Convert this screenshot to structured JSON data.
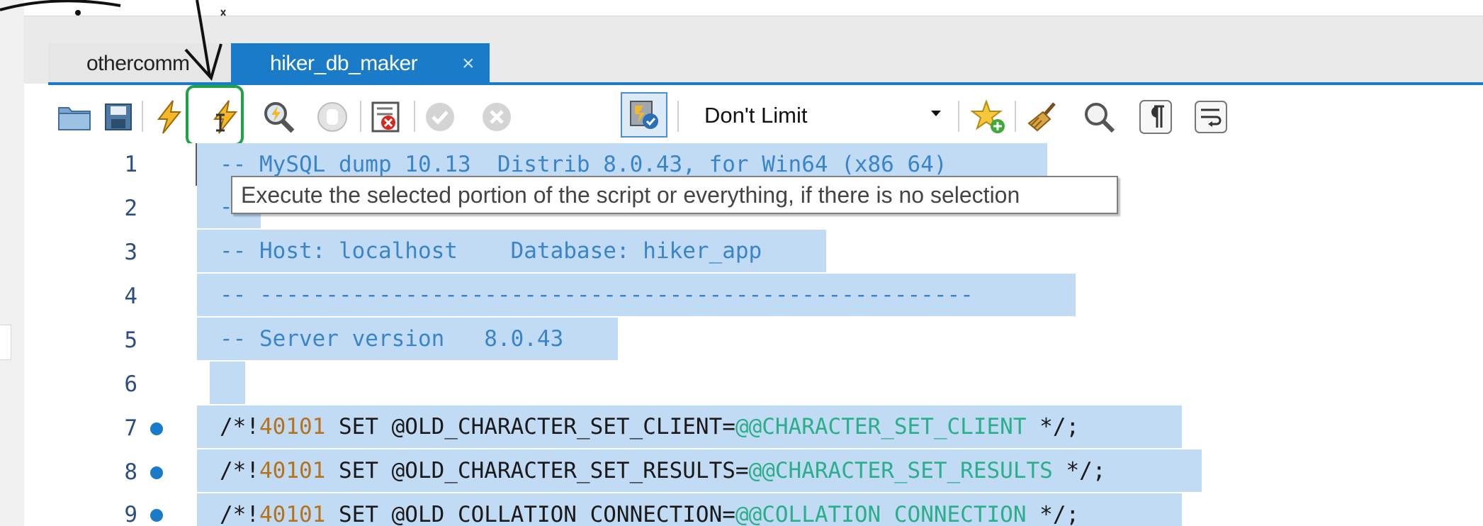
{
  "tabs": [
    {
      "label": "othercomm",
      "active": false
    },
    {
      "label": "hiker_db_maker",
      "active": true,
      "close_glyph": "×"
    }
  ],
  "toolbar": {
    "buttons": [
      {
        "name": "open-file-button",
        "icon": "folder-icon"
      },
      {
        "name": "save-file-button",
        "icon": "save-icon"
      },
      {
        "name": "execute-button",
        "icon": "lightning-icon"
      },
      {
        "name": "execute-current-statement-button",
        "icon": "lightning-cursor-icon"
      },
      {
        "name": "explain-button",
        "icon": "magnifier-lightning-icon"
      },
      {
        "name": "stop-button",
        "icon": "hand-stop-icon"
      },
      {
        "name": "toggle-error-stop-button",
        "icon": "error-stop-icon"
      },
      {
        "name": "commit-button",
        "icon": "check-icon"
      },
      {
        "name": "rollback-button",
        "icon": "cancel-icon"
      },
      {
        "name": "autocommit-toggle-button",
        "icon": "autocommit-icon"
      },
      {
        "name": "add-snippet-button",
        "icon": "star-plus-icon"
      },
      {
        "name": "beautify-button",
        "icon": "broom-icon"
      },
      {
        "name": "find-button",
        "icon": "magnifier-icon"
      },
      {
        "name": "invisible-chars-button",
        "icon": "pilcrow-icon"
      },
      {
        "name": "word-wrap-button",
        "icon": "wrap-icon"
      }
    ],
    "limit_select": {
      "value": "Don't Limit"
    }
  },
  "tooltip": {
    "text": "Execute the selected portion of the script or everything, if there is no selection"
  },
  "editor": {
    "lines": [
      {
        "num": "1",
        "text": "-- MySQL dump 10.13  Distrib 8.0.43, for Win64 (x86_64)"
      },
      {
        "num": "2",
        "text": "--"
      },
      {
        "num": "3",
        "text": "-- Host: localhost    Database: hiker_app"
      },
      {
        "num": "4",
        "text": "-- ------------------------------------------------------"
      },
      {
        "num": "5",
        "text": "-- Server version   8.0.43"
      },
      {
        "num": "6",
        "text": ""
      },
      {
        "num": "7",
        "prefix": "/*!",
        "ver": "40101",
        "kw": " SET @OLD_CHARACTER_SET_CLIENT=",
        "sys": "@@CHARACTER_SET_CLIENT",
        "tail": " */;"
      },
      {
        "num": "8",
        "prefix": "/*!",
        "ver": "40101",
        "kw": " SET @OLD_CHARACTER_SET_RESULTS=",
        "sys": "@@CHARACTER_SET_RESULTS",
        "tail": " */;"
      },
      {
        "num": "9",
        "prefix": "/*!",
        "ver": "40101",
        "kw": " SET @OLD_COLLATION_CONNECTION=",
        "sys": "@@COLLATION_CONNECTION",
        "tail": " */;"
      }
    ]
  },
  "colors": {
    "accent": "#1a7bc9",
    "selection": "#c1dbf5",
    "highlight": "#1ea34b"
  }
}
